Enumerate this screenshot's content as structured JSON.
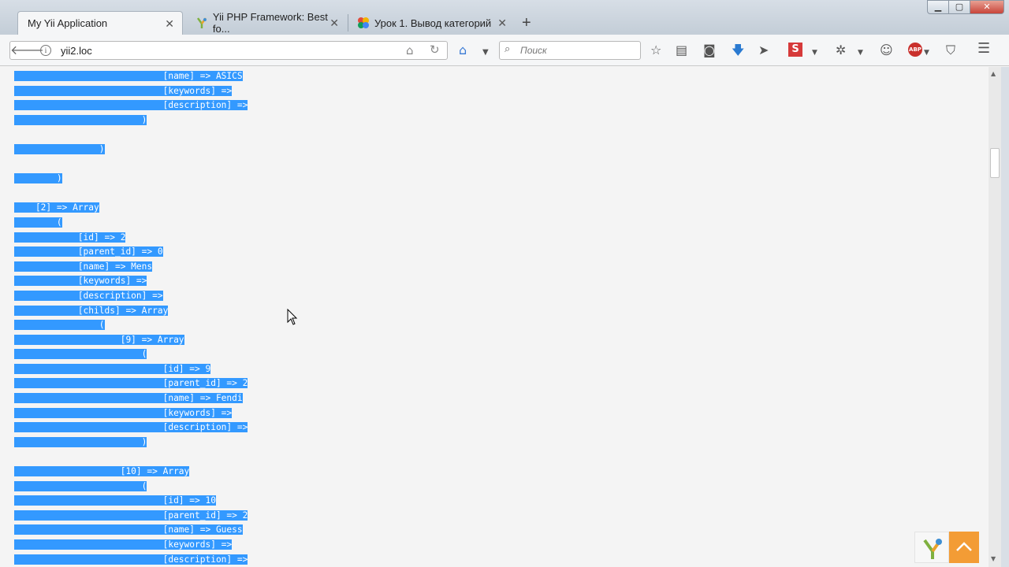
{
  "browser": {
    "tabs": [
      {
        "title": "My Yii Application",
        "active": true,
        "icon": "none"
      },
      {
        "title": "Yii PHP Framework: Best fo...",
        "active": false,
        "icon": "yii-logo-icon"
      },
      {
        "title": "Урок 1. Вывод категорий",
        "active": false,
        "icon": "puzzle-icon"
      }
    ],
    "new_tab_label": "+",
    "url": "yii2.loc",
    "search_placeholder": "Поиск"
  },
  "content": {
    "lines": [
      "                            [name] => ASICS",
      "                            [keywords] =>",
      "                            [description] =>",
      "                        )",
      "",
      "                )",
      "",
      "        )",
      "",
      "    [2] => Array",
      "        (",
      "            [id] => 2",
      "            [parent_id] => 0",
      "            [name] => Mens",
      "            [keywords] =>",
      "            [description] =>",
      "            [childs] => Array",
      "                (",
      "                    [9] => Array",
      "                        (",
      "                            [id] => 9",
      "                            [parent_id] => 2",
      "                            [name] => Fendi",
      "                            [keywords] =>",
      "                            [description] =>",
      "                        )",
      "",
      "                    [10] => Array",
      "                        (",
      "                            [id] => 10",
      "                            [parent_id] => 2",
      "                            [name] => Guess",
      "                            [keywords] =>",
      "                            [description] =>"
    ]
  },
  "colors": {
    "selection": "#3399ff",
    "scroll_top_button": "#f39c35"
  }
}
